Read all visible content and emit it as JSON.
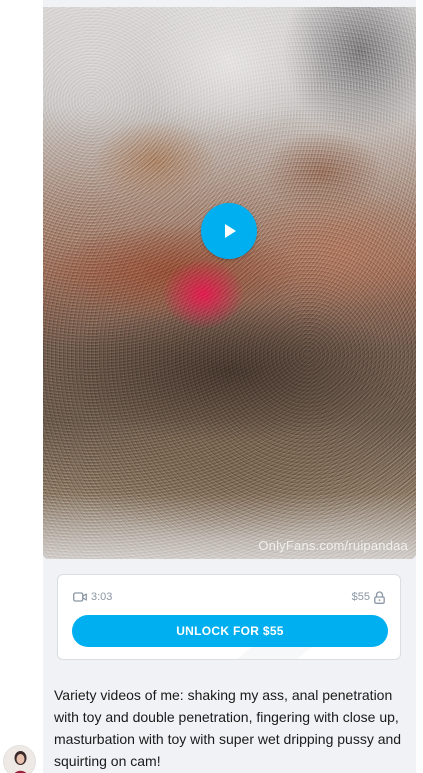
{
  "message": {
    "media": {
      "watermark": "OnlyFans.com/ruipandaa",
      "play_icon": "play-icon"
    },
    "paywall": {
      "duration": "3:03",
      "price": "$55",
      "video_icon": "video-camera-icon",
      "lock_icon": "lock-icon",
      "unlock_label": "UNLOCK FOR $55"
    },
    "caption": "Variety videos of me: shaking my ass, anal penetration with toy and double penetration, fingering with close up, masturbation with toy with super wet dripping pussy and squirting on cam!"
  },
  "colors": {
    "accent": "#00aff0",
    "bubble_bg": "#f0f2f5",
    "meta_text": "#8a96a3"
  }
}
